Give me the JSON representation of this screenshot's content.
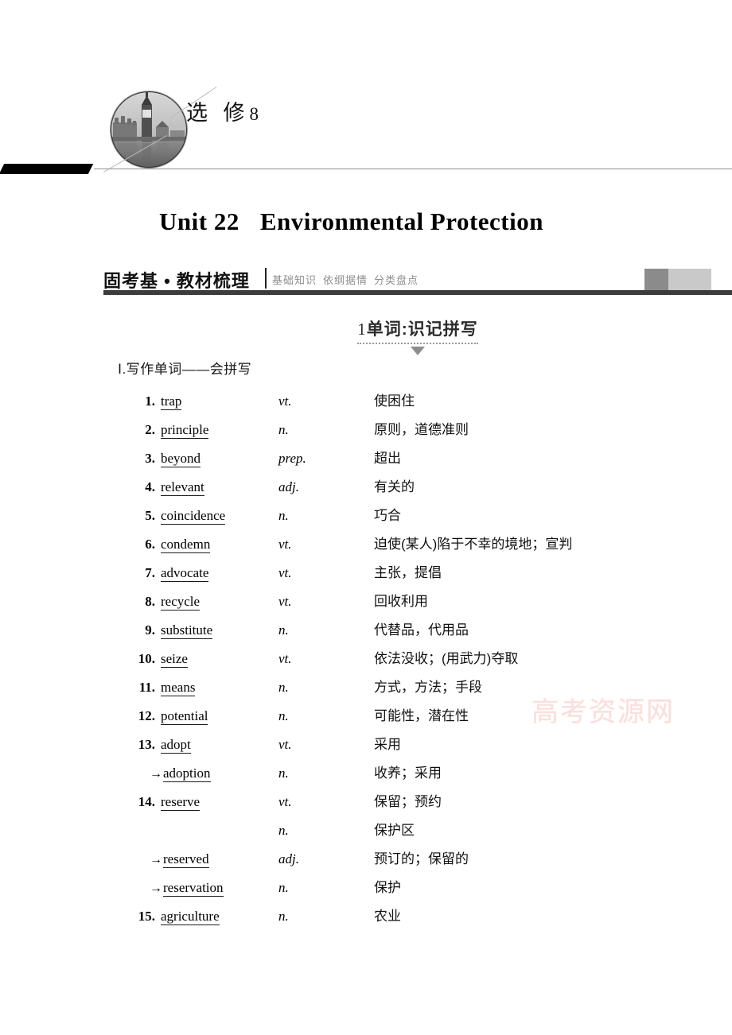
{
  "volume": {
    "label": "选 修",
    "number": "8",
    "photo_alt": "big-ben-westminster-photo"
  },
  "unit": {
    "number": "Unit 22",
    "title": "Environmental Protection"
  },
  "section_header": {
    "title": "固考基 • 教材梳理",
    "subtitles": [
      "基础知识",
      "依纲据情",
      "分类盘点"
    ]
  },
  "banner": {
    "number": "1",
    "text": "单词:识记拼写"
  },
  "list_heading": "Ⅰ.写作单词——会拼写",
  "watermark": "高考资源网",
  "colors": {
    "rule_dark": "#3c3c3c",
    "block_dark": "#8b8b8b",
    "block_light": "#c9c9c9",
    "subtitle_gray": "#8d8d8d",
    "watermark_pink": "#f6cdd6"
  },
  "vocabulary": [
    {
      "num": "1.",
      "arrow": "",
      "word": "trap",
      "pos": "vt.",
      "def": "使困住"
    },
    {
      "num": "2.",
      "arrow": "",
      "word": "principle",
      "pos": "n.",
      "def": "原则，道德准则"
    },
    {
      "num": "3.",
      "arrow": "",
      "word": "beyond",
      "pos": "prep.",
      "def": "超出"
    },
    {
      "num": "4.",
      "arrow": "",
      "word": "relevant",
      "pos": "adj.",
      "def": "有关的"
    },
    {
      "num": "5.",
      "arrow": "",
      "word": "coincidence",
      "pos": "n.",
      "def": "巧合"
    },
    {
      "num": "6.",
      "arrow": "",
      "word": "condemn",
      "pos": "vt.",
      "def": "迫使(某人)陷于不幸的境地；宣判"
    },
    {
      "num": "7.",
      "arrow": "",
      "word": "advocate",
      "pos": "vt.",
      "def": "主张，提倡"
    },
    {
      "num": "8.",
      "arrow": "",
      "word": "recycle",
      "pos": "vt.",
      "def": "回收利用"
    },
    {
      "num": "9.",
      "arrow": "",
      "word": "substitute",
      "pos": "n.",
      "def": "代替品，代用品"
    },
    {
      "num": "10.",
      "arrow": "",
      "word": "seize",
      "pos": "vt.",
      "def": "依法没收；(用武力)夺取"
    },
    {
      "num": "11.",
      "arrow": "",
      "word": "means",
      "pos": "n.",
      "def": "方式，方法；手段"
    },
    {
      "num": "12.",
      "arrow": "",
      "word": "potential",
      "pos": "n.",
      "def": "可能性，潜在性"
    },
    {
      "num": "13.",
      "arrow": "",
      "word": "adopt",
      "pos": "vt.",
      "def": "采用"
    },
    {
      "num": "",
      "arrow": "→",
      "word": "adoption",
      "pos": "n.",
      "def": "收养；采用"
    },
    {
      "num": "14.",
      "arrow": "",
      "word": "reserve",
      "pos": "vt.",
      "def": "保留；预约"
    },
    {
      "num": "",
      "arrow": "",
      "word": "",
      "pos": "n.",
      "def": "保护区"
    },
    {
      "num": "",
      "arrow": "→",
      "word": "reserved",
      "pos": "adj.",
      "def": "预订的；保留的"
    },
    {
      "num": "",
      "arrow": "→",
      "word": "reservation",
      "pos": "n.",
      "def": "保护"
    },
    {
      "num": "15.",
      "arrow": "",
      "word": "agriculture",
      "pos": "n.",
      "def": "农业"
    }
  ]
}
